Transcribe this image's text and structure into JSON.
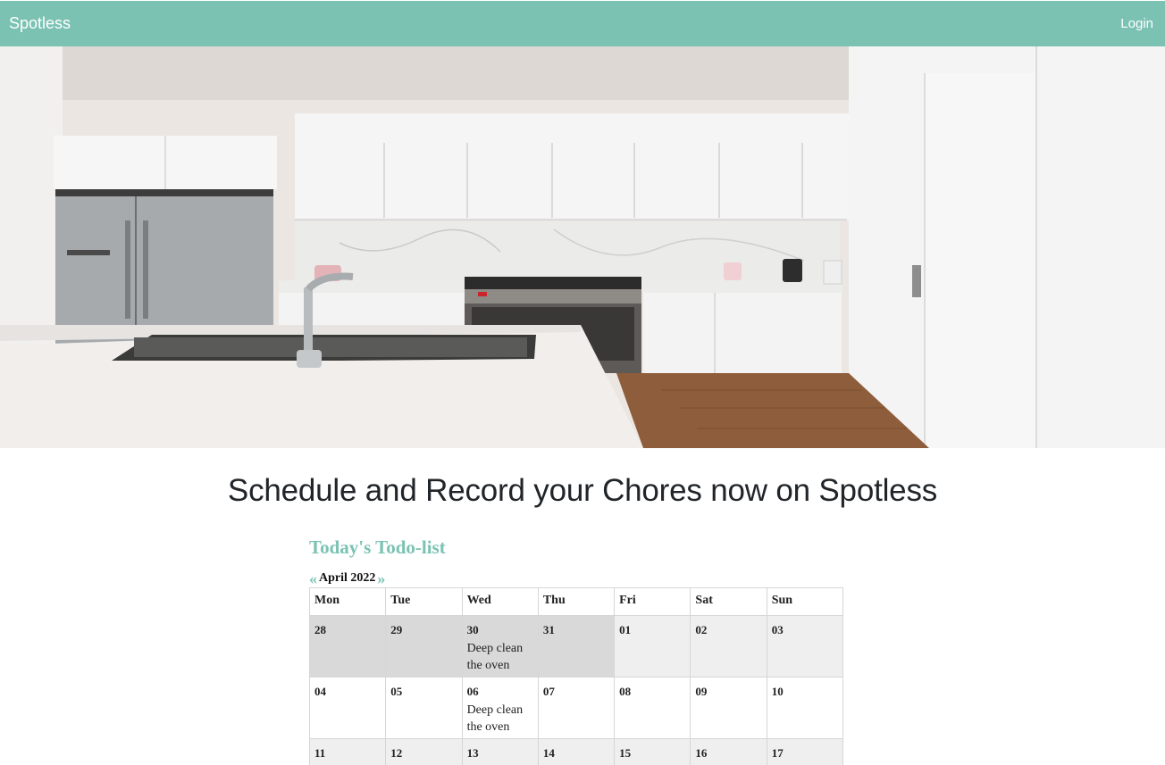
{
  "navbar": {
    "brand": "Spotless",
    "login_label": "Login"
  },
  "hero": {
    "image": "kitchen-photo"
  },
  "headline": "Schedule and Record your Chores now on Spotless",
  "calendar": {
    "title": "Today's Todo-list",
    "prev_label": "«",
    "next_label": "»",
    "month_label": "April 2022",
    "weekdays": [
      "Mon",
      "Tue",
      "Wed",
      "Thu",
      "Fri",
      "Sat",
      "Sun"
    ],
    "weeks": [
      [
        {
          "day": "28",
          "event": ""
        },
        {
          "day": "29",
          "event": ""
        },
        {
          "day": "30",
          "event": "Deep clean the oven"
        },
        {
          "day": "31",
          "event": ""
        },
        {
          "day": "01",
          "event": ""
        },
        {
          "day": "02",
          "event": ""
        },
        {
          "day": "03",
          "event": ""
        }
      ],
      [
        {
          "day": "04",
          "event": ""
        },
        {
          "day": "05",
          "event": ""
        },
        {
          "day": "06",
          "event": "Deep clean the oven"
        },
        {
          "day": "07",
          "event": ""
        },
        {
          "day": "08",
          "event": ""
        },
        {
          "day": "09",
          "event": ""
        },
        {
          "day": "10",
          "event": ""
        }
      ],
      [
        {
          "day": "11",
          "event": ""
        },
        {
          "day": "12",
          "event": ""
        },
        {
          "day": "13",
          "event": ""
        },
        {
          "day": "14",
          "event": ""
        },
        {
          "day": "15",
          "event": ""
        },
        {
          "day": "16",
          "event": ""
        },
        {
          "day": "17",
          "event": ""
        }
      ]
    ]
  },
  "colors": {
    "accent": "#7bc2b3",
    "prev_month_bg": "#d9d9d9",
    "shaded_row_bg": "#efefef"
  }
}
